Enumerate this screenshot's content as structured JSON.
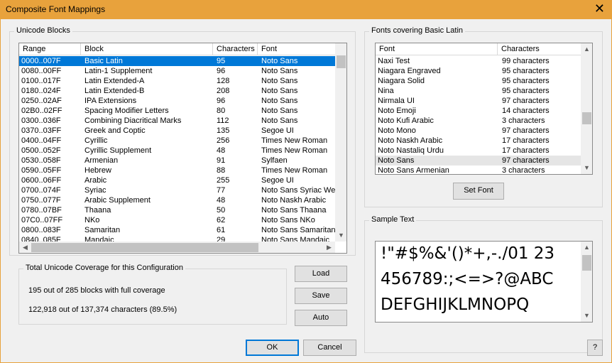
{
  "window": {
    "title": "Composite Font Mappings"
  },
  "unicode_blocks": {
    "label": "Unicode Blocks",
    "columns": [
      "Range",
      "Block",
      "Characters",
      "Font"
    ],
    "rows": [
      [
        "0000..007F",
        "Basic Latin",
        "95",
        "Noto Sans"
      ],
      [
        "0080..00FF",
        "Latin-1 Supplement",
        "96",
        "Noto Sans"
      ],
      [
        "0100..017F",
        "Latin Extended-A",
        "128",
        "Noto Sans"
      ],
      [
        "0180..024F",
        "Latin Extended-B",
        "208",
        "Noto Sans"
      ],
      [
        "0250..02AF",
        "IPA Extensions",
        "96",
        "Noto Sans"
      ],
      [
        "02B0..02FF",
        "Spacing Modifier Letters",
        "80",
        "Noto Sans"
      ],
      [
        "0300..036F",
        "Combining Diacritical Marks",
        "112",
        "Noto Sans"
      ],
      [
        "0370..03FF",
        "Greek and Coptic",
        "135",
        "Segoe UI"
      ],
      [
        "0400..04FF",
        "Cyrillic",
        "256",
        "Times New Roman"
      ],
      [
        "0500..052F",
        "Cyrillic Supplement",
        "48",
        "Times New Roman"
      ],
      [
        "0530..058F",
        "Armenian",
        "91",
        "Sylfaen"
      ],
      [
        "0590..05FF",
        "Hebrew",
        "88",
        "Times New Roman"
      ],
      [
        "0600..06FF",
        "Arabic",
        "255",
        "Segoe UI"
      ],
      [
        "0700..074F",
        "Syriac",
        "77",
        "Noto Sans Syriac Wes"
      ],
      [
        "0750..077F",
        "Arabic Supplement",
        "48",
        "Noto Naskh Arabic"
      ],
      [
        "0780..07BF",
        "Thaana",
        "50",
        "Noto Sans Thaana"
      ],
      [
        "07C0..07FF",
        "NKo",
        "62",
        "Noto Sans NKo"
      ],
      [
        "0800..083F",
        "Samaritan",
        "61",
        "Noto Sans Samaritan"
      ],
      [
        "0840..085F",
        "Mandaic",
        "29",
        "Noto Sans Mandaic"
      ]
    ],
    "selected_index": 0
  },
  "coverage": {
    "label": "Total Unicode Coverage for this Configuration",
    "blocks_line": "195 out of 285 blocks with full coverage",
    "chars_line": "122,918 out of 137,374 characters (89.5%)"
  },
  "buttons": {
    "load": "Load",
    "save": "Save",
    "auto": "Auto",
    "ok": "OK",
    "cancel": "Cancel",
    "help": "?",
    "set_font": "Set Font"
  },
  "fonts_covering": {
    "label": "Fonts covering Basic Latin",
    "columns": [
      "Font",
      "Characters"
    ],
    "rows": [
      [
        "Naxi Test",
        "99 characters"
      ],
      [
        "Niagara Engraved",
        "95 characters"
      ],
      [
        "Niagara Solid",
        "95 characters"
      ],
      [
        "Nina",
        "95 characters"
      ],
      [
        "Nirmala UI",
        "97 characters"
      ],
      [
        "Noto Emoji",
        "14 characters"
      ],
      [
        "Noto Kufi Arabic",
        "3 characters"
      ],
      [
        "Noto Mono",
        "97 characters"
      ],
      [
        "Noto Naskh Arabic",
        "17 characters"
      ],
      [
        "Noto Nastaliq Urdu",
        "17 characters"
      ],
      [
        "Noto Sans",
        "97 characters"
      ],
      [
        "Noto Sans Armenian",
        "3 characters"
      ]
    ],
    "highlighted_index": 10
  },
  "sample_text": {
    "label": "Sample Text",
    "lines": [
      "!\"#$%&'()*+,-./01 23",
      "456789:;<=>?@ABC",
      "DEFGHIJKLMNOPQ"
    ]
  },
  "icons": {
    "close": "close-icon",
    "up": "arrow-up-icon",
    "down": "arrow-down-icon",
    "left": "arrow-left-icon",
    "right": "arrow-right-icon"
  }
}
